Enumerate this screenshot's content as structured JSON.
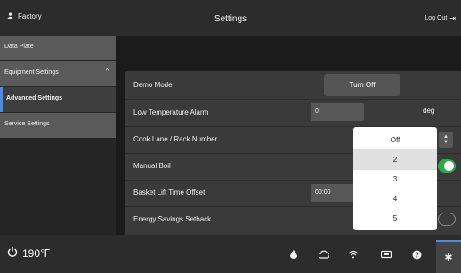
{
  "header": {
    "user": "Factory",
    "title": "Settings",
    "logout": "Log Out"
  },
  "sidebar": {
    "items": [
      {
        "label": "Data Plate"
      },
      {
        "label": "Equipment Settings"
      },
      {
        "label": "Advanced Settings"
      },
      {
        "label": "Service Settings"
      }
    ]
  },
  "settings": {
    "demo_mode": {
      "label": "Demo Mode",
      "button": "Turn Off"
    },
    "low_temp": {
      "label": "Low Temperature Alarm",
      "value": "0",
      "unit": "deg"
    },
    "cook_lane": {
      "label": "Cook Lane / Rack Number"
    },
    "manual_boil": {
      "label": "Manual Boil",
      "state": "on"
    },
    "basket_offset": {
      "label": "Basket Lift Time Offset",
      "value": "00:00"
    },
    "energy_setback": {
      "label": "Energy Savings Setback",
      "state": "off"
    }
  },
  "dropdown": {
    "options": [
      "Off",
      "2",
      "3",
      "4",
      "5"
    ],
    "selected": "2"
  },
  "footer": {
    "temperature": "190℉",
    "icons": [
      "oil-drop-icon",
      "cloud-icon",
      "wifi-icon",
      "usb-icon",
      "help-icon",
      "gear-icon"
    ]
  },
  "colors": {
    "accent": "#4a8de0",
    "toggle_on": "#2ea84a"
  }
}
